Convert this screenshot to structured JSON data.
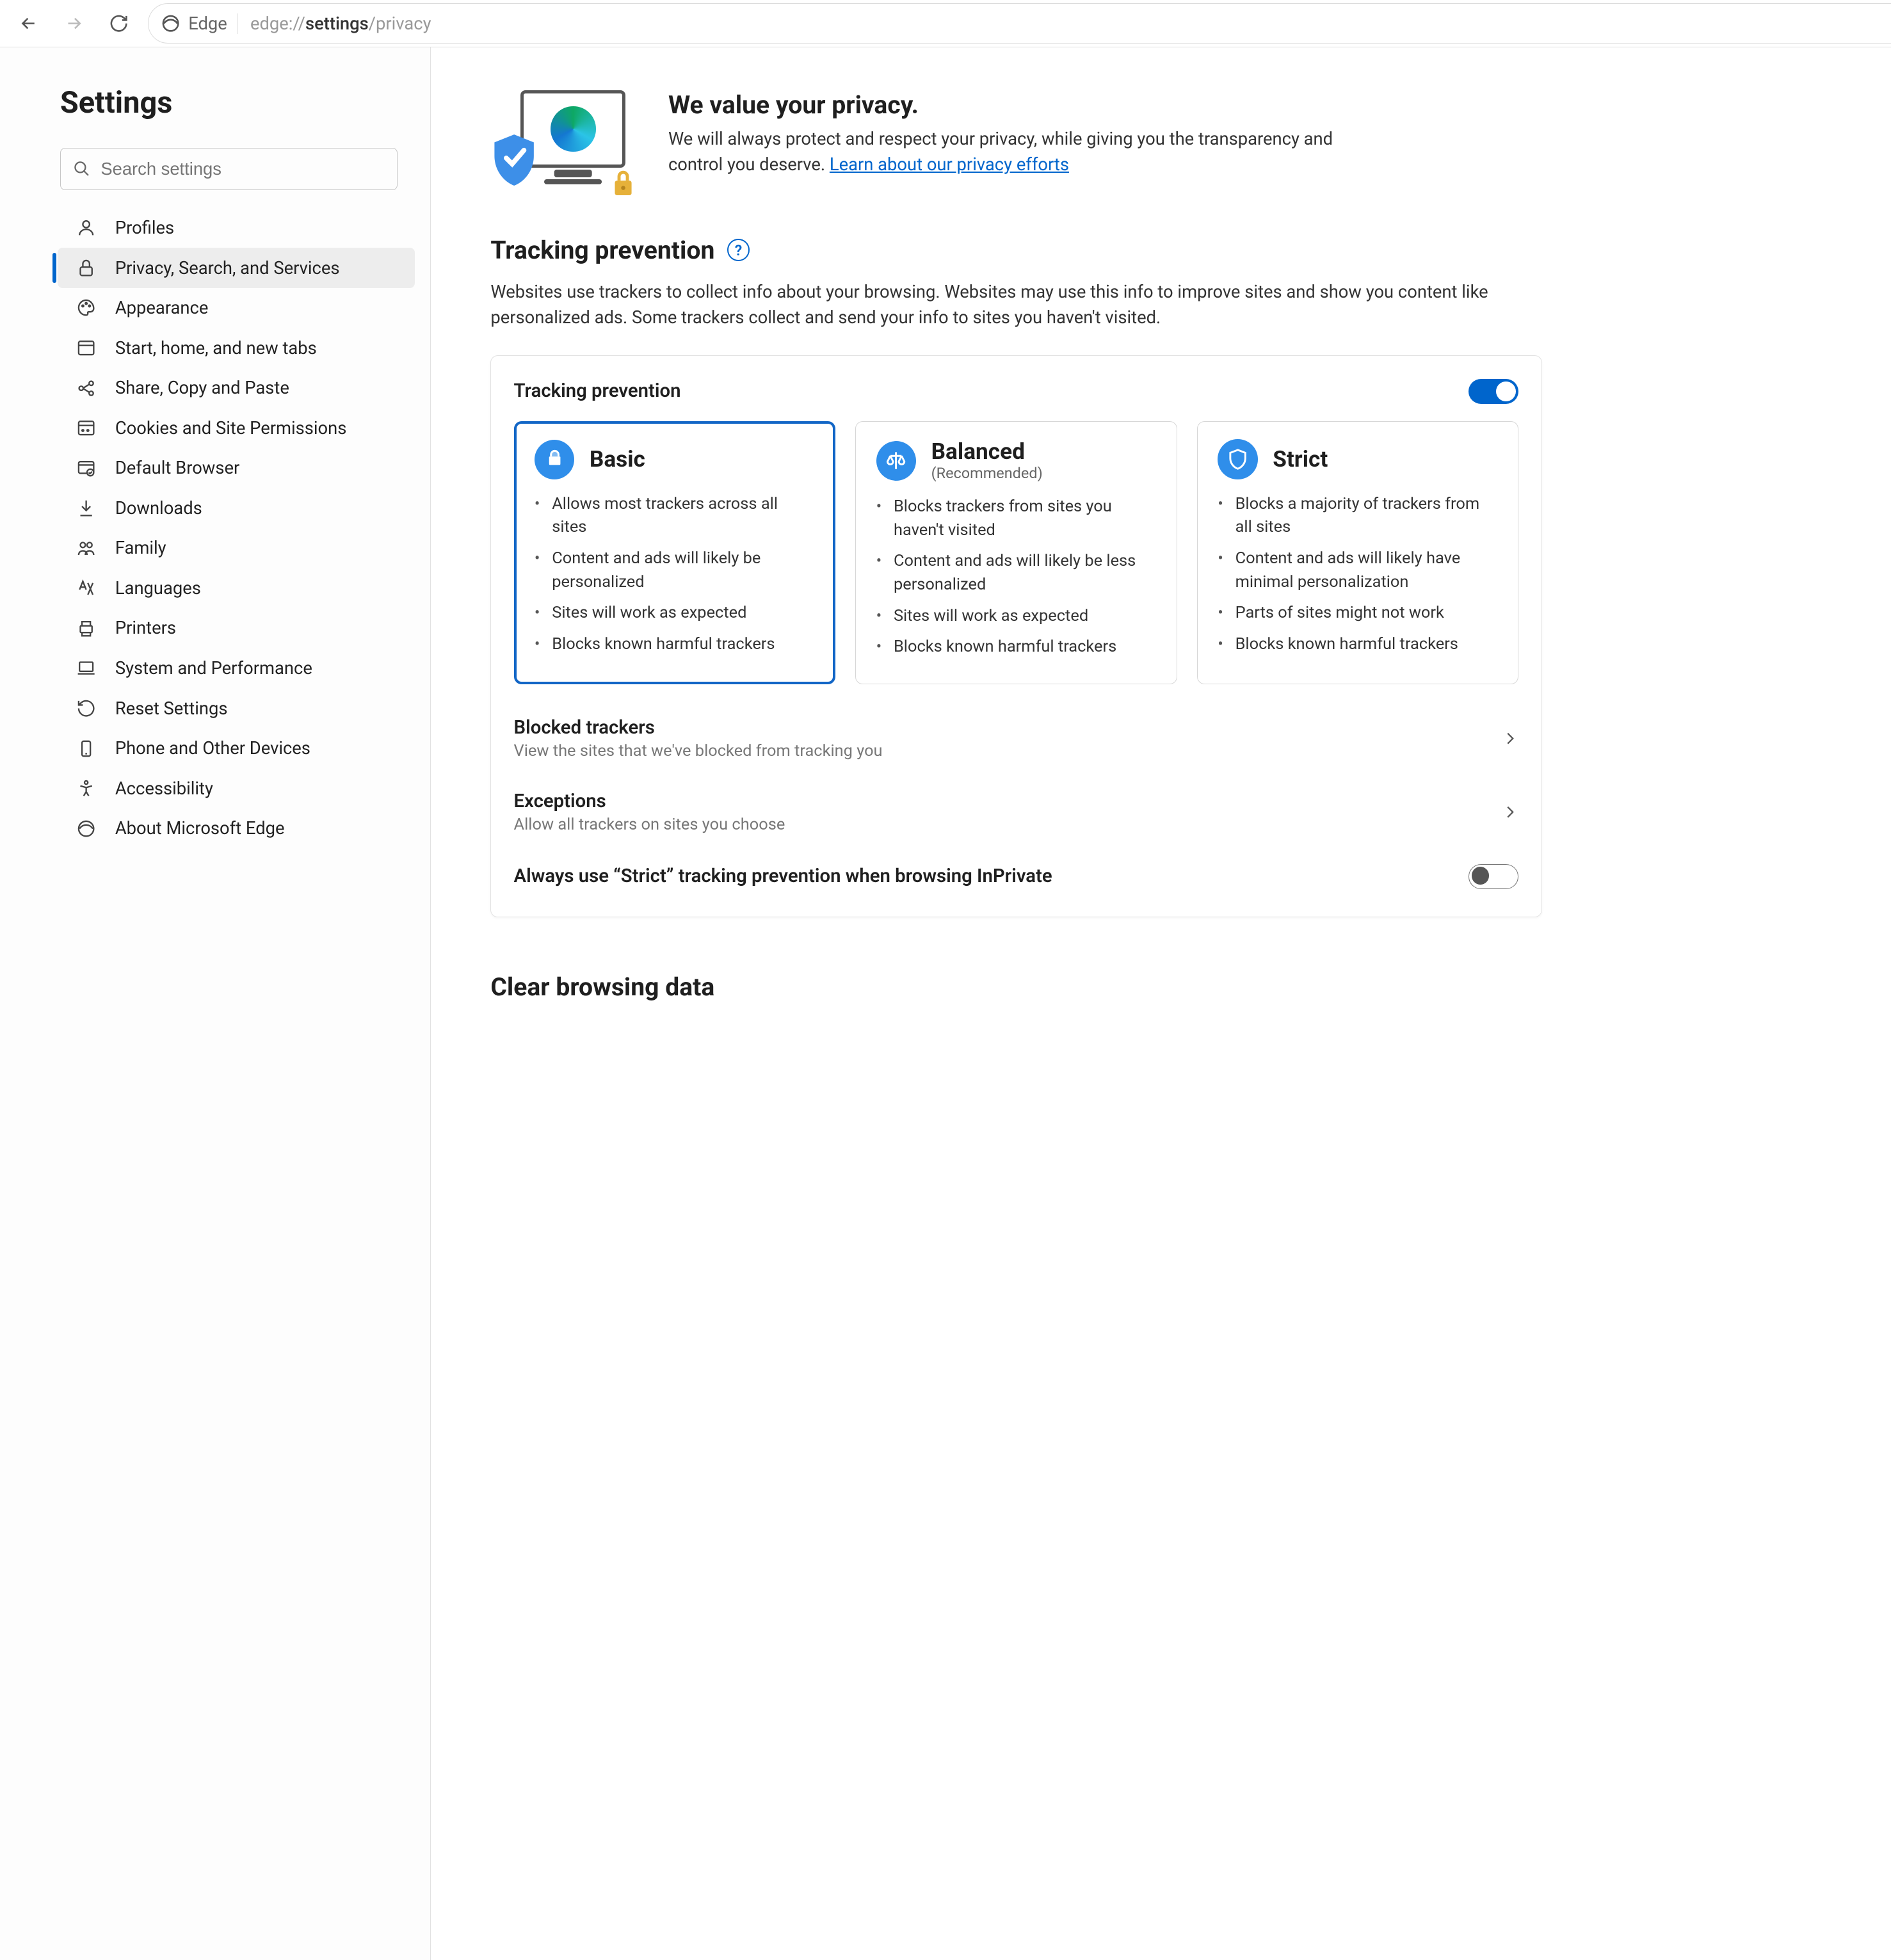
{
  "toolbar": {
    "app_name": "Edge",
    "url_prefix": "edge://",
    "url_bold": "settings",
    "url_suffix": "/privacy"
  },
  "sidebar": {
    "title": "Settings",
    "search_placeholder": "Search settings",
    "items": [
      {
        "label": "Profiles",
        "icon": "profile"
      },
      {
        "label": "Privacy, Search, and Services",
        "icon": "lock",
        "selected": true
      },
      {
        "label": "Appearance",
        "icon": "palette"
      },
      {
        "label": "Start, home, and new tabs",
        "icon": "window"
      },
      {
        "label": "Share, Copy and Paste",
        "icon": "share"
      },
      {
        "label": "Cookies and Site Permissions",
        "icon": "cookie"
      },
      {
        "label": "Default Browser",
        "icon": "browser"
      },
      {
        "label": "Downloads",
        "icon": "download"
      },
      {
        "label": "Family",
        "icon": "family"
      },
      {
        "label": "Languages",
        "icon": "language"
      },
      {
        "label": "Printers",
        "icon": "printer"
      },
      {
        "label": "System and Performance",
        "icon": "laptop"
      },
      {
        "label": "Reset Settings",
        "icon": "reset"
      },
      {
        "label": "Phone and Other Devices",
        "icon": "phone"
      },
      {
        "label": "Accessibility",
        "icon": "accessibility"
      },
      {
        "label": "About Microsoft Edge",
        "icon": "edge"
      }
    ]
  },
  "hero": {
    "title": "We value your privacy.",
    "body": "We will always protect and respect your privacy, while giving you the transparency and control you deserve. ",
    "link": "Learn about our privacy efforts"
  },
  "tracking": {
    "title": "Tracking prevention",
    "desc": "Websites use trackers to collect info about your browsing. Websites may use this info to improve sites and show you content like personalized ads. Some trackers collect and send your info to sites you haven't visited.",
    "card_label": "Tracking prevention",
    "master_enabled": true,
    "selected_level": 0,
    "levels": [
      {
        "name": "Basic",
        "subtitle": "",
        "bullets": [
          "Allows most trackers across all sites",
          "Content and ads will likely be personalized",
          "Sites will work as expected",
          "Blocks known harmful trackers"
        ]
      },
      {
        "name": "Balanced",
        "subtitle": "(Recommended)",
        "bullets": [
          "Blocks trackers from sites you haven't visited",
          "Content and ads will likely be less personalized",
          "Sites will work as expected",
          "Blocks known harmful trackers"
        ]
      },
      {
        "name": "Strict",
        "subtitle": "",
        "bullets": [
          "Blocks a majority of trackers from all sites",
          "Content and ads will likely have minimal personalization",
          "Parts of sites might not work",
          "Blocks known harmful trackers"
        ]
      }
    ],
    "rows": {
      "blocked": {
        "title": "Blocked trackers",
        "sub": "View the sites that we've blocked from tracking you"
      },
      "exceptions": {
        "title": "Exceptions",
        "sub": "Allow all trackers on sites you choose"
      },
      "strict_inprivate": {
        "title": "Always use “Strict” tracking prevention when browsing InPrivate",
        "enabled": false
      }
    }
  },
  "clear_data": {
    "title": "Clear browsing data"
  }
}
